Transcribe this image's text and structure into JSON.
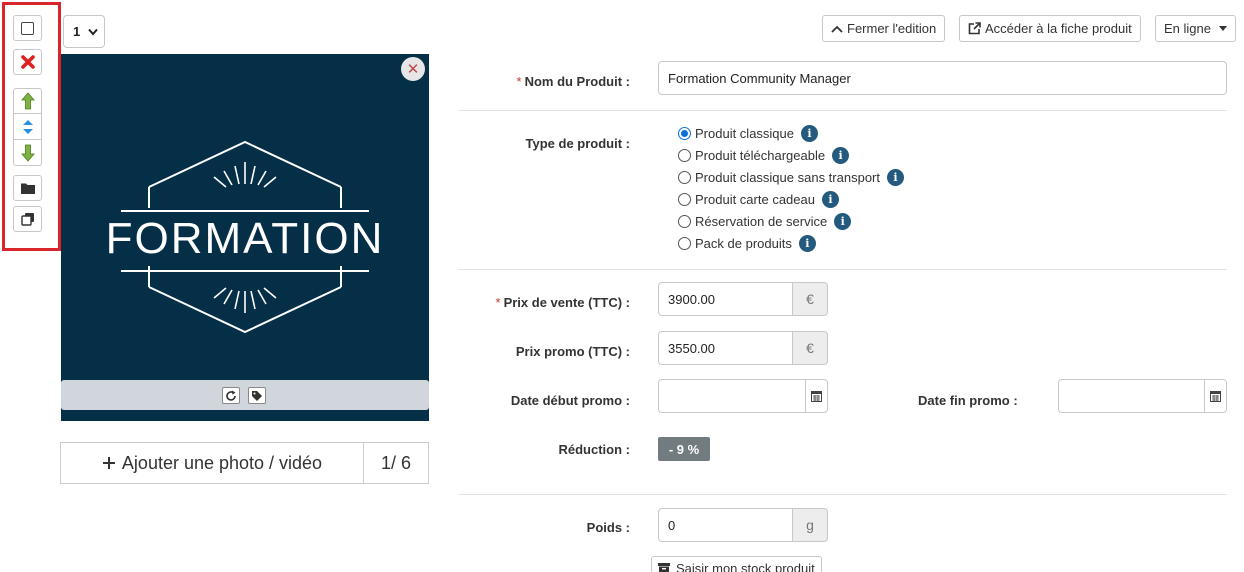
{
  "toolbar": {
    "checkbox_icon": "checkbox-icon",
    "delete_icon": "delete-icon",
    "move_up_icon": "move-up-icon",
    "move_icon": "move-icon",
    "move_down_icon": "move-down-icon",
    "folder_icon": "folder-icon",
    "duplicate_icon": "duplicate-icon",
    "highlight_color": "#d9262a"
  },
  "page_select": {
    "value": "1"
  },
  "image": {
    "text": "FORMATION",
    "background": "#052f47"
  },
  "add_photo": {
    "label": "Ajouter une photo / vidéo",
    "count": "1/ 6"
  },
  "header_buttons": {
    "close_edit": "Fermer l'edition",
    "open_product": "Accéder à la fiche produit",
    "status": "En ligne"
  },
  "form": {
    "name_label": "Nom du Produit :",
    "name_value": "Formation Community Manager",
    "type_label": "Type de produit :",
    "types": [
      {
        "label": "Produit classique",
        "checked": true
      },
      {
        "label": "Produit téléchargeable",
        "checked": false
      },
      {
        "label": "Produit classique sans transport",
        "checked": false
      },
      {
        "label": "Produit carte cadeau",
        "checked": false
      },
      {
        "label": "Réservation de service",
        "checked": false
      },
      {
        "label": "Pack de produits",
        "checked": false
      }
    ],
    "price_label": "Prix de vente (TTC) :",
    "price_value": "3900.00",
    "currency": "€",
    "promo_label": "Prix promo (TTC) :",
    "promo_value": "3550.00",
    "promo_start_label": "Date début promo :",
    "promo_end_label": "Date fin promo :",
    "reduction_label": "Réduction :",
    "reduction_value": "- 9 %",
    "weight_label": "Poids :",
    "weight_value": "0",
    "weight_unit": "g",
    "stock_button": "Saisir mon stock produit"
  }
}
